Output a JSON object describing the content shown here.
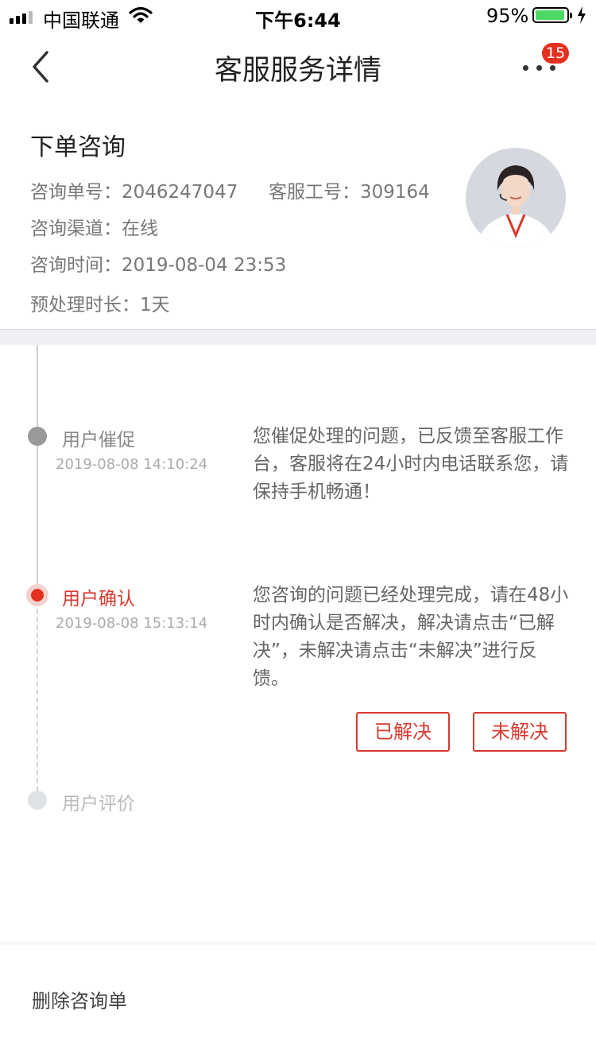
{
  "status_bar": {
    "carrier": "中国联通",
    "time": "下午6:44",
    "battery_percent": "95%",
    "battery_level": 0.95
  },
  "nav": {
    "title": "客服服务详情",
    "badge_count": "15"
  },
  "info": {
    "title": "下单咨询",
    "order_no_label": "咨询单号：",
    "order_no": "2046247047",
    "staff_id_label": "客服工号：",
    "staff_id": "309164",
    "channel_label": "咨询渠道：",
    "channel": "在线",
    "time_label": "咨询时间：",
    "time": "2019-08-04 23:53",
    "duration_label": "预处理时长：",
    "duration": "1天"
  },
  "timeline": [
    {
      "label": "用户催促",
      "time": "2019-08-08 14:10:24",
      "description": "您催促处理的问题，已反馈至客服工作台，客服将在24小时内电话联系您，请保持手机畅通！",
      "state": "done"
    },
    {
      "label": "用户确认",
      "time": "2019-08-08 15:13:14",
      "description": "您咨询的问题已经处理完成，请在48小时内确认是否解决，解决请点击“已解决”，未解决请点击“未解决”进行反馈。",
      "state": "current"
    },
    {
      "label": "用户评价",
      "state": "pending"
    }
  ],
  "actions": {
    "resolved": "已解决",
    "unresolved": "未解决"
  },
  "footer": {
    "delete_label": "删除咨询单"
  },
  "colors": {
    "accent": "#d9392f",
    "badge": "#e5301f",
    "battery": "#4cd964",
    "done_dot": "#999999",
    "pending_dot": "#dfe2e6"
  }
}
